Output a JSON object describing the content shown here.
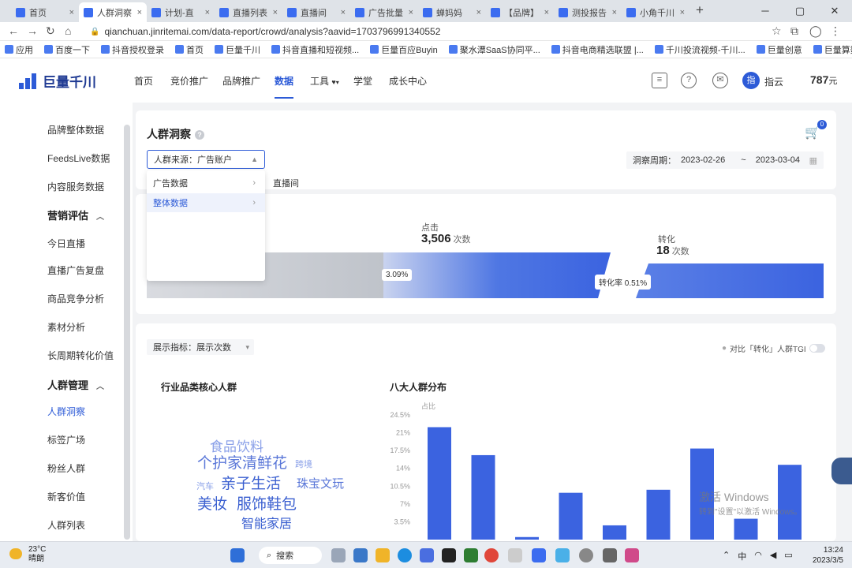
{
  "browser": {
    "tabs": [
      "首页",
      "人群洞察",
      "计划-直",
      "直播列表",
      "直播间",
      "广告批量",
      "蝉妈妈",
      "【品牌】",
      "测投报告",
      "小角千川"
    ],
    "active_tab": 1,
    "url": "qianchuan.jinritemai.com/data-report/crowd/analysis?aavid=1703796991340552",
    "bookmarks": [
      "应用",
      "百度一下",
      "抖音授权登录",
      "首页",
      "巨量千川",
      "抖音直播和短视频...",
      "巨量百应Buyin",
      "聚水潭SaaS协同平...",
      "抖音电商精选联盟 |...",
      "千川投流视频-千川...",
      "巨量创意",
      "巨量算数-解析内容..."
    ]
  },
  "header": {
    "brand": "巨量千川",
    "nav": [
      "首页",
      "竞价推广",
      "品牌推广",
      "数据",
      "工具",
      "学堂",
      "成长中心"
    ],
    "active_nav": "数据",
    "avatar_text": "指",
    "username": "指云",
    "balance_value": "787",
    "balance_unit": "元"
  },
  "sidebar": {
    "items_top": [
      "品牌整体数据",
      "FeedsLive数据",
      "内容服务数据"
    ],
    "group_marketing": "营销评估",
    "marketing_items": [
      "今日直播",
      "直播广告复盘",
      "商品竞争分析",
      "素材分析",
      "长周期转化价值"
    ],
    "group_crowd": "人群管理",
    "crowd_items": [
      "人群洞察",
      "标签广场",
      "粉丝人群",
      "新客价值",
      "人群列表"
    ],
    "active_item": "人群洞察"
  },
  "page": {
    "title": "人群洞察",
    "cart_badge": "0",
    "source_select": "人群来源：广告账户",
    "dropdown": {
      "options": [
        "广告数据",
        "整体数据"
      ],
      "highlighted": "整体数据",
      "submenu_item": "直播间"
    },
    "period_label": "洞察周期：",
    "period_start": "2023-02-26",
    "period_sep": "~",
    "period_end": "2023-03-04"
  },
  "funnel": {
    "click_label": "点击",
    "click_value": "3,506",
    "click_unit": "次数",
    "conv_label": "转化",
    "conv_value": "18",
    "conv_unit": "次数",
    "rate_left": "3.09%",
    "rate_conv": "转化率  0.51%"
  },
  "insight": {
    "metric_select": "展示指标：展示次数",
    "compare_label": "对比「转化」人群TGI",
    "core_title": "行业品类核心人群",
    "dist_title": "八大人群分布",
    "cloud_words": [
      {
        "text": "食品饮料",
        "size": 17
      },
      {
        "text": "个护家清",
        "size": 19
      },
      {
        "text": "鲜花",
        "size": 19
      },
      {
        "text": "跨境",
        "size": 11
      },
      {
        "text": "汽车",
        "size": 11
      },
      {
        "text": "亲子生活",
        "size": 19
      },
      {
        "text": "珠宝文玩",
        "size": 15
      },
      {
        "text": "美妆",
        "size": 19
      },
      {
        "text": "服饰鞋包",
        "size": 19
      },
      {
        "text": "智能家居",
        "size": 16
      }
    ]
  },
  "chart_data": {
    "type": "bar",
    "title": "八大人群分布",
    "ylabel": "占比",
    "yticks": [
      "24.5%",
      "21%",
      "17.5%",
      "14%",
      "10.5%",
      "7%",
      "3.5%"
    ],
    "ylim": [
      0,
      24.5
    ],
    "values": [
      22.1,
      16.6,
      0.5,
      9.2,
      2.8,
      9.8,
      17.9,
      4.1,
      14.7
    ],
    "bar_color": "#3b63e0"
  },
  "overlay": {
    "watermark_line1": "激活 Windows",
    "watermark_line2": "转到\"设置\"以激活 Windows。"
  },
  "taskbar": {
    "weather_temp": "23°C",
    "weather_text": "晴朗",
    "search_label": "搜索",
    "ime": "中",
    "time": "13:24",
    "date": "2023/3/5"
  }
}
